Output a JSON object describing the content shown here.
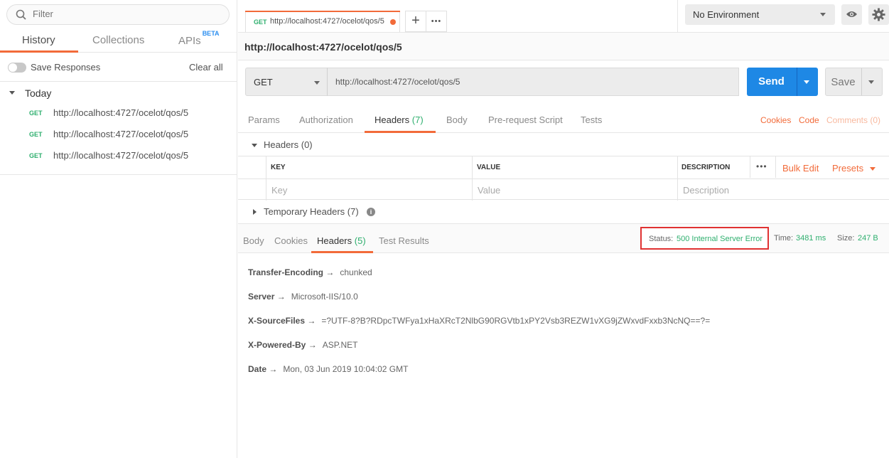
{
  "sidebar": {
    "filter_placeholder": "Filter",
    "tabs": [
      {
        "label": "History"
      },
      {
        "label": "Collections"
      },
      {
        "label": "APIs",
        "badge": "BETA"
      }
    ],
    "save_responses_label": "Save Responses",
    "clear_all_label": "Clear all",
    "group_label": "Today",
    "history_items": [
      {
        "method": "GET",
        "url": "http://localhost:4727/ocelot/qos/5"
      },
      {
        "method": "GET",
        "url": "http://localhost:4727/ocelot/qos/5"
      },
      {
        "method": "GET",
        "url": "http://localhost:4727/ocelot/qos/5"
      }
    ]
  },
  "tabbar": {
    "tab": {
      "method": "GET",
      "title": "http://localhost:4727/ocelot/qos/5"
    },
    "add_label": "+",
    "more_label": "•••",
    "environment": "No Environment"
  },
  "request": {
    "heading": "http://localhost:4727/ocelot/qos/5",
    "method": "GET",
    "url": "http://localhost:4727/ocelot/qos/5",
    "send_label": "Send",
    "save_label": "Save",
    "tabs": [
      {
        "label": "Params"
      },
      {
        "label": "Authorization"
      },
      {
        "label": "Headers",
        "count": "(7)"
      },
      {
        "label": "Body"
      },
      {
        "label": "Pre-request Script"
      },
      {
        "label": "Tests"
      }
    ],
    "cookies_label": "Cookies",
    "code_label": "Code",
    "comments_label": "Comments (0)",
    "headers_section": "Headers (0)",
    "table": {
      "columns": [
        "KEY",
        "VALUE",
        "DESCRIPTION"
      ],
      "more": "•••",
      "bulk_edit": "Bulk Edit",
      "presets": "Presets",
      "placeholders": {
        "key": "Key",
        "value": "Value",
        "description": "Description"
      }
    },
    "temp_headers": "Temporary Headers (7)"
  },
  "response": {
    "tabs": [
      {
        "label": "Body"
      },
      {
        "label": "Cookies"
      },
      {
        "label": "Headers",
        "count": "(5)"
      },
      {
        "label": "Test Results"
      }
    ],
    "status_label": "Status:",
    "status_value": "500 Internal Server Error",
    "time_label": "Time:",
    "time_value": "3481 ms",
    "size_label": "Size:",
    "size_value": "247 B",
    "headers": [
      {
        "name": "Transfer-Encoding",
        "arrow": "→",
        "value": "chunked"
      },
      {
        "name": "Server",
        "arrow": "→",
        "value": "Microsoft-IIS/10.0"
      },
      {
        "name": "X-SourceFiles",
        "arrow": "→",
        "value": "=?UTF-8?B?RDpcTWFya1xHaXRcT2NlbG90RGVtb1xPY2Vsb3REZW1vXG9jZWxvdFxxb3NcNQ==?="
      },
      {
        "name": "X-Powered-By",
        "arrow": "→",
        "value": "ASP.NET"
      },
      {
        "name": "Date",
        "arrow": "→",
        "value": "Mon, 03 Jun 2019 10:04:02 GMT"
      }
    ]
  },
  "colors": {
    "accent": "#f26b3a",
    "send": "#1e88e5",
    "success": "#2eaf6e",
    "highlight": "#e03232"
  }
}
